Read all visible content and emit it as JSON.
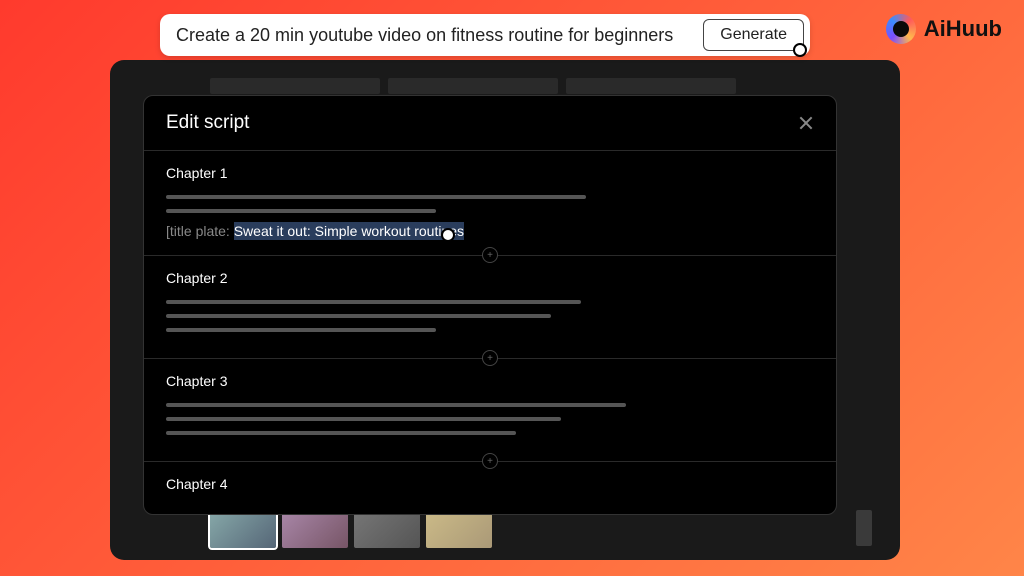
{
  "brand": {
    "name": "AiHuub"
  },
  "prompt": {
    "value": "Create a 20 min youtube video on fitness routine for beginners",
    "generate_label": "Generate"
  },
  "modal": {
    "title": "Edit script",
    "chapters": [
      {
        "title": "Chapter 1",
        "title_plate_prefix": "[title plate: ",
        "title_plate_value": "Sweat it out: Simple workout routines",
        "lines": [
          420,
          270
        ]
      },
      {
        "title": "Chapter 2",
        "lines": [
          415,
          385,
          270
        ]
      },
      {
        "title": "Chapter 3",
        "lines": [
          460,
          395,
          350
        ]
      },
      {
        "title": "Chapter 4",
        "lines": []
      }
    ],
    "add_icon": "+"
  }
}
